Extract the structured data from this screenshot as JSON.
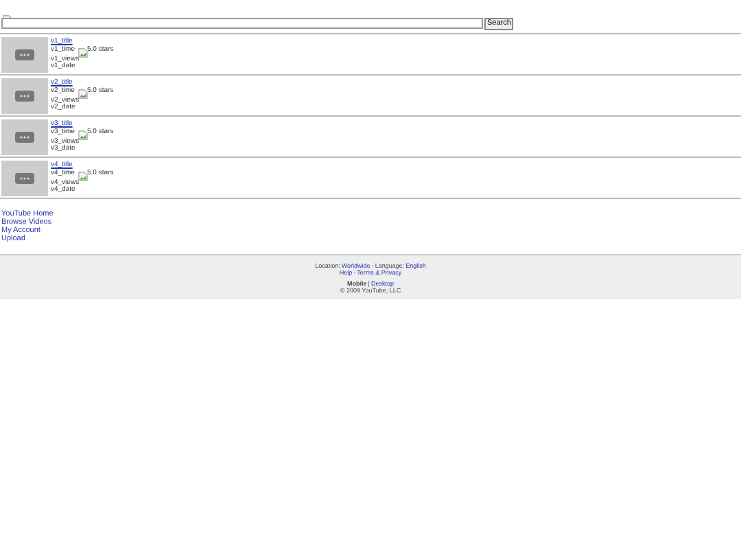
{
  "search": {
    "button": "Search"
  },
  "videos": [
    {
      "title": "v1_title",
      "time": "v1_time",
      "rating": "5.0 stars",
      "views": "v1_views",
      "date": "v1_date"
    },
    {
      "title": "v2_title",
      "time": "v2_time",
      "rating": "5.0 stars",
      "views": "v2_views",
      "date": "v2_date"
    },
    {
      "title": "v3_title",
      "time": "v3_time",
      "rating": "5.0 stars",
      "views": "v3_views",
      "date": "v3_date"
    },
    {
      "title": "v4_title",
      "time": "v4_time",
      "rating": "5.0 stars",
      "views": "v4_views",
      "date": "v4_date"
    }
  ],
  "nav_links": [
    "YouTube Home",
    "Browse Videos",
    "My Account",
    "Upload"
  ],
  "footer": {
    "location_label": "Location:",
    "location": "Worldwide",
    "separator": "-",
    "language_label": "Language:",
    "language": "English",
    "help": "Help",
    "dash": "-",
    "terms": "Terms & Privacy",
    "mobile": "Mobile",
    "bar": "|",
    "desktop": "Desktop",
    "copyright": "© 2009 YouTube, LLC"
  }
}
